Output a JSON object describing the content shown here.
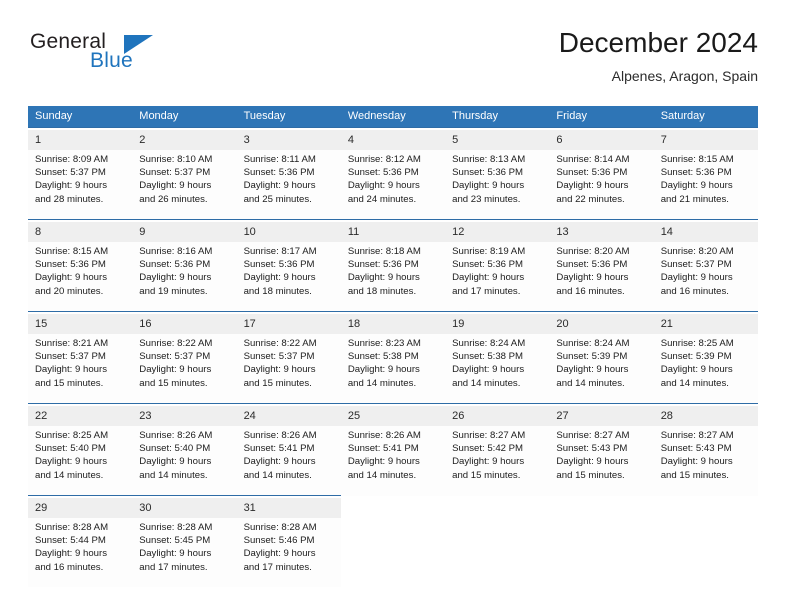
{
  "brand": {
    "name_top": "General",
    "name_bottom": "Blue",
    "icon": "triangle-flag-icon",
    "color_text": "#231f20",
    "color_accent": "#1f74bd"
  },
  "header": {
    "title": "December 2024",
    "location": "Alpenes, Aragon, Spain"
  },
  "theme": {
    "header_bg": "#2e75b6",
    "header_text": "#ffffff",
    "daynum_bg": "#efefef",
    "week_separator": "#2e6ca6"
  },
  "weekday_headers": [
    "Sunday",
    "Monday",
    "Tuesday",
    "Wednesday",
    "Thursday",
    "Friday",
    "Saturday"
  ],
  "weeks": [
    [
      {
        "day": "1",
        "sunrise": "Sunrise: 8:09 AM",
        "sunset": "Sunset: 5:37 PM",
        "daylight1": "Daylight: 9 hours",
        "daylight2": "and 28 minutes."
      },
      {
        "day": "2",
        "sunrise": "Sunrise: 8:10 AM",
        "sunset": "Sunset: 5:37 PM",
        "daylight1": "Daylight: 9 hours",
        "daylight2": "and 26 minutes."
      },
      {
        "day": "3",
        "sunrise": "Sunrise: 8:11 AM",
        "sunset": "Sunset: 5:36 PM",
        "daylight1": "Daylight: 9 hours",
        "daylight2": "and 25 minutes."
      },
      {
        "day": "4",
        "sunrise": "Sunrise: 8:12 AM",
        "sunset": "Sunset: 5:36 PM",
        "daylight1": "Daylight: 9 hours",
        "daylight2": "and 24 minutes."
      },
      {
        "day": "5",
        "sunrise": "Sunrise: 8:13 AM",
        "sunset": "Sunset: 5:36 PM",
        "daylight1": "Daylight: 9 hours",
        "daylight2": "and 23 minutes."
      },
      {
        "day": "6",
        "sunrise": "Sunrise: 8:14 AM",
        "sunset": "Sunset: 5:36 PM",
        "daylight1": "Daylight: 9 hours",
        "daylight2": "and 22 minutes."
      },
      {
        "day": "7",
        "sunrise": "Sunrise: 8:15 AM",
        "sunset": "Sunset: 5:36 PM",
        "daylight1": "Daylight: 9 hours",
        "daylight2": "and 21 minutes."
      }
    ],
    [
      {
        "day": "8",
        "sunrise": "Sunrise: 8:15 AM",
        "sunset": "Sunset: 5:36 PM",
        "daylight1": "Daylight: 9 hours",
        "daylight2": "and 20 minutes."
      },
      {
        "day": "9",
        "sunrise": "Sunrise: 8:16 AM",
        "sunset": "Sunset: 5:36 PM",
        "daylight1": "Daylight: 9 hours",
        "daylight2": "and 19 minutes."
      },
      {
        "day": "10",
        "sunrise": "Sunrise: 8:17 AM",
        "sunset": "Sunset: 5:36 PM",
        "daylight1": "Daylight: 9 hours",
        "daylight2": "and 18 minutes."
      },
      {
        "day": "11",
        "sunrise": "Sunrise: 8:18 AM",
        "sunset": "Sunset: 5:36 PM",
        "daylight1": "Daylight: 9 hours",
        "daylight2": "and 18 minutes."
      },
      {
        "day": "12",
        "sunrise": "Sunrise: 8:19 AM",
        "sunset": "Sunset: 5:36 PM",
        "daylight1": "Daylight: 9 hours",
        "daylight2": "and 17 minutes."
      },
      {
        "day": "13",
        "sunrise": "Sunrise: 8:20 AM",
        "sunset": "Sunset: 5:36 PM",
        "daylight1": "Daylight: 9 hours",
        "daylight2": "and 16 minutes."
      },
      {
        "day": "14",
        "sunrise": "Sunrise: 8:20 AM",
        "sunset": "Sunset: 5:37 PM",
        "daylight1": "Daylight: 9 hours",
        "daylight2": "and 16 minutes."
      }
    ],
    [
      {
        "day": "15",
        "sunrise": "Sunrise: 8:21 AM",
        "sunset": "Sunset: 5:37 PM",
        "daylight1": "Daylight: 9 hours",
        "daylight2": "and 15 minutes."
      },
      {
        "day": "16",
        "sunrise": "Sunrise: 8:22 AM",
        "sunset": "Sunset: 5:37 PM",
        "daylight1": "Daylight: 9 hours",
        "daylight2": "and 15 minutes."
      },
      {
        "day": "17",
        "sunrise": "Sunrise: 8:22 AM",
        "sunset": "Sunset: 5:37 PM",
        "daylight1": "Daylight: 9 hours",
        "daylight2": "and 15 minutes."
      },
      {
        "day": "18",
        "sunrise": "Sunrise: 8:23 AM",
        "sunset": "Sunset: 5:38 PM",
        "daylight1": "Daylight: 9 hours",
        "daylight2": "and 14 minutes."
      },
      {
        "day": "19",
        "sunrise": "Sunrise: 8:24 AM",
        "sunset": "Sunset: 5:38 PM",
        "daylight1": "Daylight: 9 hours",
        "daylight2": "and 14 minutes."
      },
      {
        "day": "20",
        "sunrise": "Sunrise: 8:24 AM",
        "sunset": "Sunset: 5:39 PM",
        "daylight1": "Daylight: 9 hours",
        "daylight2": "and 14 minutes."
      },
      {
        "day": "21",
        "sunrise": "Sunrise: 8:25 AM",
        "sunset": "Sunset: 5:39 PM",
        "daylight1": "Daylight: 9 hours",
        "daylight2": "and 14 minutes."
      }
    ],
    [
      {
        "day": "22",
        "sunrise": "Sunrise: 8:25 AM",
        "sunset": "Sunset: 5:40 PM",
        "daylight1": "Daylight: 9 hours",
        "daylight2": "and 14 minutes."
      },
      {
        "day": "23",
        "sunrise": "Sunrise: 8:26 AM",
        "sunset": "Sunset: 5:40 PM",
        "daylight1": "Daylight: 9 hours",
        "daylight2": "and 14 minutes."
      },
      {
        "day": "24",
        "sunrise": "Sunrise: 8:26 AM",
        "sunset": "Sunset: 5:41 PM",
        "daylight1": "Daylight: 9 hours",
        "daylight2": "and 14 minutes."
      },
      {
        "day": "25",
        "sunrise": "Sunrise: 8:26 AM",
        "sunset": "Sunset: 5:41 PM",
        "daylight1": "Daylight: 9 hours",
        "daylight2": "and 14 minutes."
      },
      {
        "day": "26",
        "sunrise": "Sunrise: 8:27 AM",
        "sunset": "Sunset: 5:42 PM",
        "daylight1": "Daylight: 9 hours",
        "daylight2": "and 15 minutes."
      },
      {
        "day": "27",
        "sunrise": "Sunrise: 8:27 AM",
        "sunset": "Sunset: 5:43 PM",
        "daylight1": "Daylight: 9 hours",
        "daylight2": "and 15 minutes."
      },
      {
        "day": "28",
        "sunrise": "Sunrise: 8:27 AM",
        "sunset": "Sunset: 5:43 PM",
        "daylight1": "Daylight: 9 hours",
        "daylight2": "and 15 minutes."
      }
    ],
    [
      {
        "day": "29",
        "sunrise": "Sunrise: 8:28 AM",
        "sunset": "Sunset: 5:44 PM",
        "daylight1": "Daylight: 9 hours",
        "daylight2": "and 16 minutes."
      },
      {
        "day": "30",
        "sunrise": "Sunrise: 8:28 AM",
        "sunset": "Sunset: 5:45 PM",
        "daylight1": "Daylight: 9 hours",
        "daylight2": "and 17 minutes."
      },
      {
        "day": "31",
        "sunrise": "Sunrise: 8:28 AM",
        "sunset": "Sunset: 5:46 PM",
        "daylight1": "Daylight: 9 hours",
        "daylight2": "and 17 minutes."
      },
      {
        "day": "",
        "sunrise": "",
        "sunset": "",
        "daylight1": "",
        "daylight2": ""
      },
      {
        "day": "",
        "sunrise": "",
        "sunset": "",
        "daylight1": "",
        "daylight2": ""
      },
      {
        "day": "",
        "sunrise": "",
        "sunset": "",
        "daylight1": "",
        "daylight2": ""
      },
      {
        "day": "",
        "sunrise": "",
        "sunset": "",
        "daylight1": "",
        "daylight2": ""
      }
    ]
  ]
}
